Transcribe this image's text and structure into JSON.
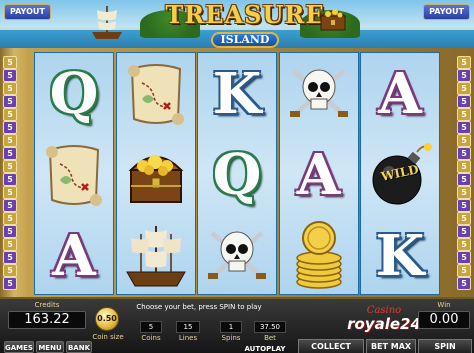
{
  "header": {
    "payout_left": "PAYOUT",
    "payout_right": "PAYOUT",
    "logo_title": "TREASURE",
    "logo_subtitle": "ISLAND"
  },
  "paylines_left": [
    "5",
    "5",
    "5",
    "5",
    "5",
    "5",
    "5",
    "5",
    "5",
    "5",
    "5",
    "5",
    "5",
    "5",
    "5",
    "5",
    "5",
    "5"
  ],
  "paylines_right": [
    "5",
    "5",
    "5",
    "5",
    "5",
    "5",
    "5",
    "5",
    "5",
    "5",
    "5",
    "5",
    "5",
    "5",
    "5",
    "5",
    "5",
    "5"
  ],
  "reels": [
    [
      "Q",
      "map",
      "A"
    ],
    [
      "map",
      "chest",
      "ship"
    ],
    [
      "K",
      "Q",
      "skull"
    ],
    [
      "skull",
      "A",
      "coins"
    ],
    [
      "A",
      "bomb",
      "K"
    ]
  ],
  "wild_label": "WILD",
  "panel": {
    "credits_label": "Credits",
    "credits_value": "163.22",
    "coin_value": "0.50",
    "coin_size_label": "Coin size",
    "prompt": "Choose your bet, press SPIN to play",
    "coins_value": "5",
    "coins_label": "Coins",
    "lines_value": "15",
    "lines_label": "Lines",
    "spins_value": "1",
    "spins_label": "Spins",
    "bet_value": "37.50",
    "bet_label": "Bet",
    "games_label": "GAMES",
    "menu_label": "MENU",
    "bank_label": "BANK",
    "autoplay_label": "AUTOPLAY",
    "brand_top": "Casino",
    "brand_main": "royale24",
    "collect_label": "COLLECT",
    "betmax_label": "BET MAX",
    "win_label": "Win",
    "win_value": "0.00",
    "spin_label": "SPIN"
  },
  "colors": {
    "payline_palette": [
      "#c9a33c",
      "#6a3fb0"
    ],
    "frame_gold": "#c3a04d",
    "reel_bg": "#cfe6f5"
  }
}
